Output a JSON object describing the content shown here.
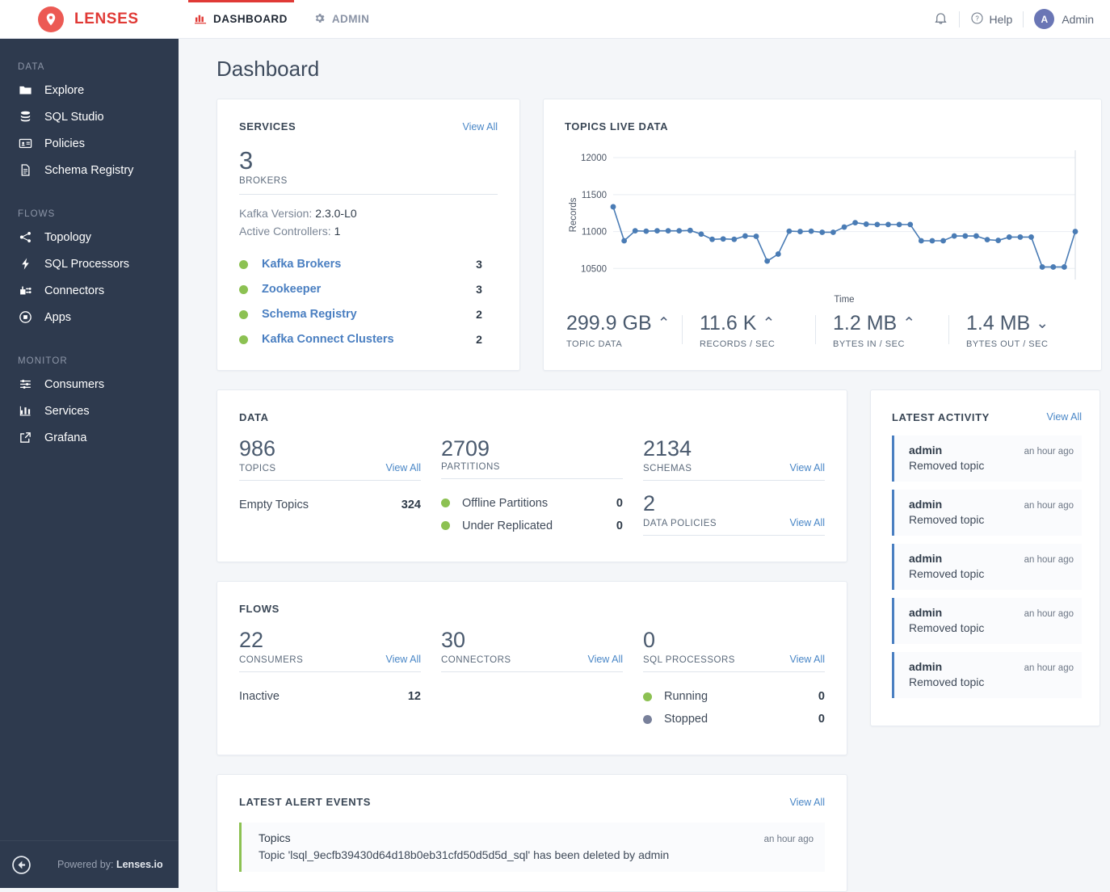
{
  "brand": {
    "name": "LENSES",
    "logo_icon": "location-pin-icon"
  },
  "topnav": {
    "items": [
      {
        "label": "DASHBOARD",
        "icon": "bar-chart-icon",
        "active": true
      },
      {
        "label": "ADMIN",
        "icon": "gear-icon",
        "active": false
      }
    ],
    "bell_icon": "bell-icon",
    "help_label": "Help",
    "help_icon": "question-circle-icon",
    "user_initial": "A",
    "user_label": "Admin",
    "accent_red": "#e03a36"
  },
  "sidebar": {
    "groups": [
      {
        "label": "DATA",
        "items": [
          {
            "label": "Explore",
            "icon": "folder-icon"
          },
          {
            "label": "SQL Studio",
            "icon": "database-icon"
          },
          {
            "label": "Policies",
            "icon": "id-card-icon"
          },
          {
            "label": "Schema Registry",
            "icon": "document-icon"
          }
        ]
      },
      {
        "label": "FLOWS",
        "items": [
          {
            "label": "Topology",
            "icon": "share-nodes-icon"
          },
          {
            "label": "SQL Processors",
            "icon": "lightning-bolt-icon"
          },
          {
            "label": "Connectors",
            "icon": "connector-icon"
          },
          {
            "label": "Apps",
            "icon": "apps-circle-icon"
          }
        ]
      },
      {
        "label": "MONITOR",
        "items": [
          {
            "label": "Consumers",
            "icon": "sliders-icon"
          },
          {
            "label": "Services",
            "icon": "bar-chart-icon"
          },
          {
            "label": "Grafana",
            "icon": "external-link-icon"
          }
        ]
      }
    ],
    "collapse_icon": "collapse-left-arrow-icon",
    "powered_prefix": "Powered by:",
    "powered_name": "Lenses.io",
    "bg": "#2e3a4e"
  },
  "page": {
    "title": "Dashboard"
  },
  "services": {
    "title": "SERVICES",
    "view_all": "View All",
    "brokers_count": "3",
    "brokers_caption": "BROKERS",
    "kafka_version_label": "Kafka Version:",
    "kafka_version_value": "2.3.0-L0",
    "active_controllers_label": "Active Controllers:",
    "active_controllers_value": "1",
    "list": [
      {
        "name": "Kafka Brokers",
        "count": "3",
        "status": "ok"
      },
      {
        "name": "Zookeeper",
        "count": "3",
        "status": "ok"
      },
      {
        "name": "Schema Registry",
        "count": "2",
        "status": "ok"
      },
      {
        "name": "Kafka Connect Clusters",
        "count": "2",
        "status": "ok"
      }
    ],
    "status_ok_color": "#8cc152"
  },
  "live": {
    "title": "TOPICS LIVE DATA",
    "metrics": [
      {
        "value": "299.9 GB",
        "trend": "up",
        "caption": "TOPIC DATA"
      },
      {
        "value": "11.6 K",
        "trend": "up",
        "caption": "RECORDS / SEC"
      },
      {
        "value": "1.2 MB",
        "trend": "up",
        "caption": "BYTES IN / SEC"
      },
      {
        "value": "1.4 MB",
        "trend": "down",
        "caption": "BYTES OUT / SEC"
      }
    ]
  },
  "chart_data": {
    "type": "line",
    "title": "TOPICS LIVE DATA",
    "xlabel": "Time",
    "ylabel": "Records",
    "ylim": [
      10350,
      12100
    ],
    "yticks": [
      10500,
      11000,
      11500,
      12000
    ],
    "grid": true,
    "legend": false,
    "marker": "circle",
    "line_color": "#4a7cb5",
    "x": [
      0,
      1,
      2,
      3,
      4,
      5,
      6,
      7,
      8,
      9,
      10,
      11,
      12,
      13,
      14,
      15,
      16,
      17,
      18,
      19,
      20,
      21,
      22,
      23,
      24,
      25,
      26,
      27,
      28,
      29,
      30,
      31,
      32,
      33,
      34,
      35,
      36,
      37,
      38,
      39,
      40,
      41,
      42,
      43,
      44,
      45,
      46,
      47,
      48,
      49,
      50,
      51
    ],
    "values": [
      11335,
      10875,
      11010,
      11005,
      11010,
      11010,
      11010,
      11015,
      10965,
      10895,
      10900,
      10895,
      10940,
      10935,
      10600,
      10695,
      11005,
      11000,
      11005,
      10990,
      10990,
      11060,
      11120,
      11100,
      11095,
      11095,
      11095,
      11095,
      10875,
      10875,
      10875,
      10940,
      10940,
      10940,
      10890,
      10880,
      10925,
      10925,
      10925,
      10520,
      10520,
      10520,
      11000
    ],
    "series": [
      {
        "name": "Records",
        "values": [
          11335,
          10875,
          11010,
          11005,
          11010,
          11010,
          11010,
          11015,
          10965,
          10895,
          10900,
          10895,
          10940,
          10935,
          10600,
          10695,
          11005,
          11000,
          11005,
          10990,
          10990,
          11060,
          11120,
          11100,
          11095,
          11095,
          11095,
          11095,
          10875,
          10875,
          10875,
          10940,
          10940,
          10940,
          10890,
          10880,
          10925,
          10925,
          10925,
          10520,
          10520,
          10520,
          11000
        ]
      }
    ]
  },
  "data_card": {
    "title": "DATA",
    "columns": [
      {
        "num": "986",
        "caption": "TOPICS",
        "view_all": "View All"
      },
      {
        "num": "2709",
        "caption": "PARTITIONS",
        "view_all": ""
      },
      {
        "num": "2134",
        "caption": "SCHEMAS",
        "view_all": "View All"
      }
    ],
    "empty_topics_label": "Empty Topics",
    "empty_topics_value": "324",
    "offline_partitions_label": "Offline Partitions",
    "offline_partitions_value": "0",
    "under_replicated_label": "Under Replicated",
    "under_replicated_value": "0",
    "policies_num": "2",
    "policies_caption": "DATA POLICIES",
    "policies_view_all": "View All"
  },
  "flows_card": {
    "title": "FLOWS",
    "columns": [
      {
        "num": "22",
        "caption": "CONSUMERS",
        "view_all": "View All"
      },
      {
        "num": "30",
        "caption": "CONNECTORS",
        "view_all": "View All"
      },
      {
        "num": "0",
        "caption": "SQL PROCESSORS",
        "view_all": "View All"
      }
    ],
    "inactive_label": "Inactive",
    "inactive_value": "12",
    "running_label": "Running",
    "running_value": "0",
    "stopped_label": "Stopped",
    "stopped_value": "0"
  },
  "activity": {
    "title": "LATEST ACTIVITY",
    "view_all": "View All",
    "items": [
      {
        "user": "admin",
        "time": "an hour ago",
        "text": "Removed topic"
      },
      {
        "user": "admin",
        "time": "an hour ago",
        "text": "Removed topic"
      },
      {
        "user": "admin",
        "time": "an hour ago",
        "text": "Removed topic"
      },
      {
        "user": "admin",
        "time": "an hour ago",
        "text": "Removed topic"
      },
      {
        "user": "admin",
        "time": "an hour ago",
        "text": "Removed topic"
      }
    ]
  },
  "alerts": {
    "title": "LATEST ALERT EVENTS",
    "view_all": "View All",
    "items": [
      {
        "title": "Topics",
        "time": "an hour ago",
        "text": "Topic 'lsql_9ecfb39430d64d18b0eb31cfd50d5d5d_sql' has been deleted by admin"
      }
    ]
  }
}
